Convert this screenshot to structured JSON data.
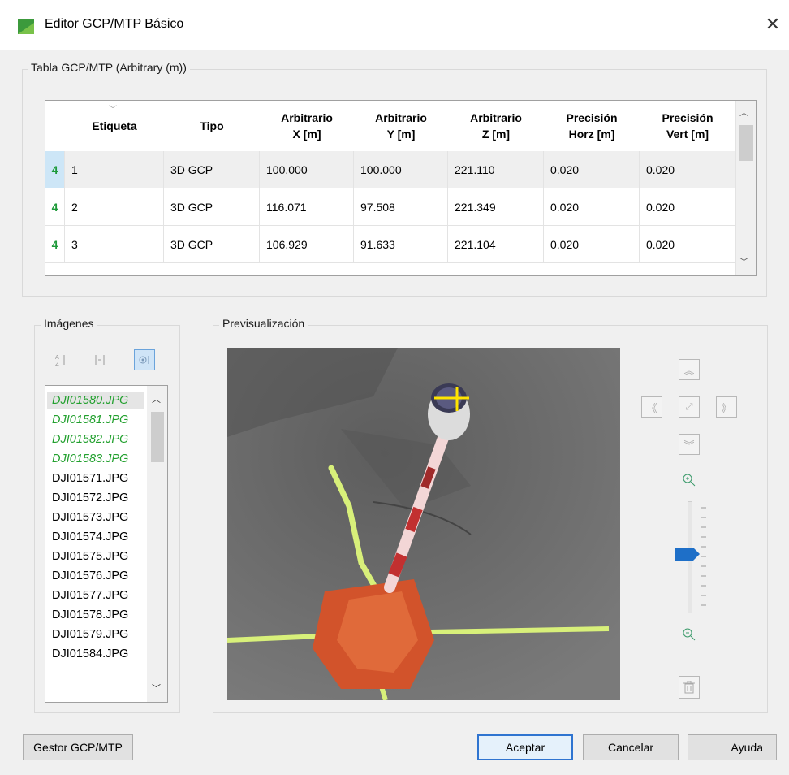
{
  "window": {
    "title": "Editor GCP/MTP Básico",
    "close_glyph": "✕"
  },
  "table_group": {
    "legend": "Tabla GCP/MTP (Arbitrary (m))",
    "columns": [
      {
        "line1": "",
        "line2": ""
      },
      {
        "line1": "Etiqueta",
        "line2": ""
      },
      {
        "line1": "Tipo",
        "line2": ""
      },
      {
        "line1": "Arbitrario",
        "line2": "X [m]"
      },
      {
        "line1": "Arbitrario",
        "line2": "Y [m]"
      },
      {
        "line1": "Arbitrario",
        "line2": "Z [m]"
      },
      {
        "line1": "Precisión",
        "line2": "Horz [m]"
      },
      {
        "line1": "Precisión",
        "line2": "Vert [m]"
      }
    ],
    "rows": [
      {
        "n": "4",
        "label": "1",
        "type": "3D GCP",
        "x": "100.000",
        "y": "100.000",
        "z": "221.110",
        "horz": "0.020",
        "vert": "0.020"
      },
      {
        "n": "4",
        "label": "2",
        "type": "3D GCP",
        "x": "116.071",
        "y": "97.508",
        "z": "221.349",
        "horz": "0.020",
        "vert": "0.020"
      },
      {
        "n": "4",
        "label": "3",
        "type": "3D GCP",
        "x": "106.929",
        "y": "91.633",
        "z": "221.104",
        "horz": "0.020",
        "vert": "0.020"
      }
    ]
  },
  "images_group": {
    "legend": "Imágenes",
    "items": [
      {
        "name": "DJI01580.JPG",
        "green": true
      },
      {
        "name": "DJI01581.JPG",
        "green": true
      },
      {
        "name": "DJI01582.JPG",
        "green": true
      },
      {
        "name": "DJI01583.JPG",
        "green": true
      },
      {
        "name": "DJI01571.JPG",
        "green": false
      },
      {
        "name": "DJI01572.JPG",
        "green": false
      },
      {
        "name": "DJI01573.JPG",
        "green": false
      },
      {
        "name": "DJI01574.JPG",
        "green": false
      },
      {
        "name": "DJI01575.JPG",
        "green": false
      },
      {
        "name": "DJI01576.JPG",
        "green": false
      },
      {
        "name": "DJI01577.JPG",
        "green": false
      },
      {
        "name": "DJI01578.JPG",
        "green": false
      },
      {
        "name": "DJI01579.JPG",
        "green": false
      },
      {
        "name": "DJI01584.JPG",
        "green": false
      }
    ]
  },
  "preview_group": {
    "legend": "Previsualización",
    "zoom_level": 0.5
  },
  "buttons": {
    "manager": "Gestor GCP/MTP",
    "accept": "Aceptar",
    "cancel": "Cancelar",
    "help": "Ayuda"
  },
  "colors": {
    "accent": "#2f74d0",
    "green_text": "#22a02e",
    "slider_thumb": "#1e6fc8"
  }
}
